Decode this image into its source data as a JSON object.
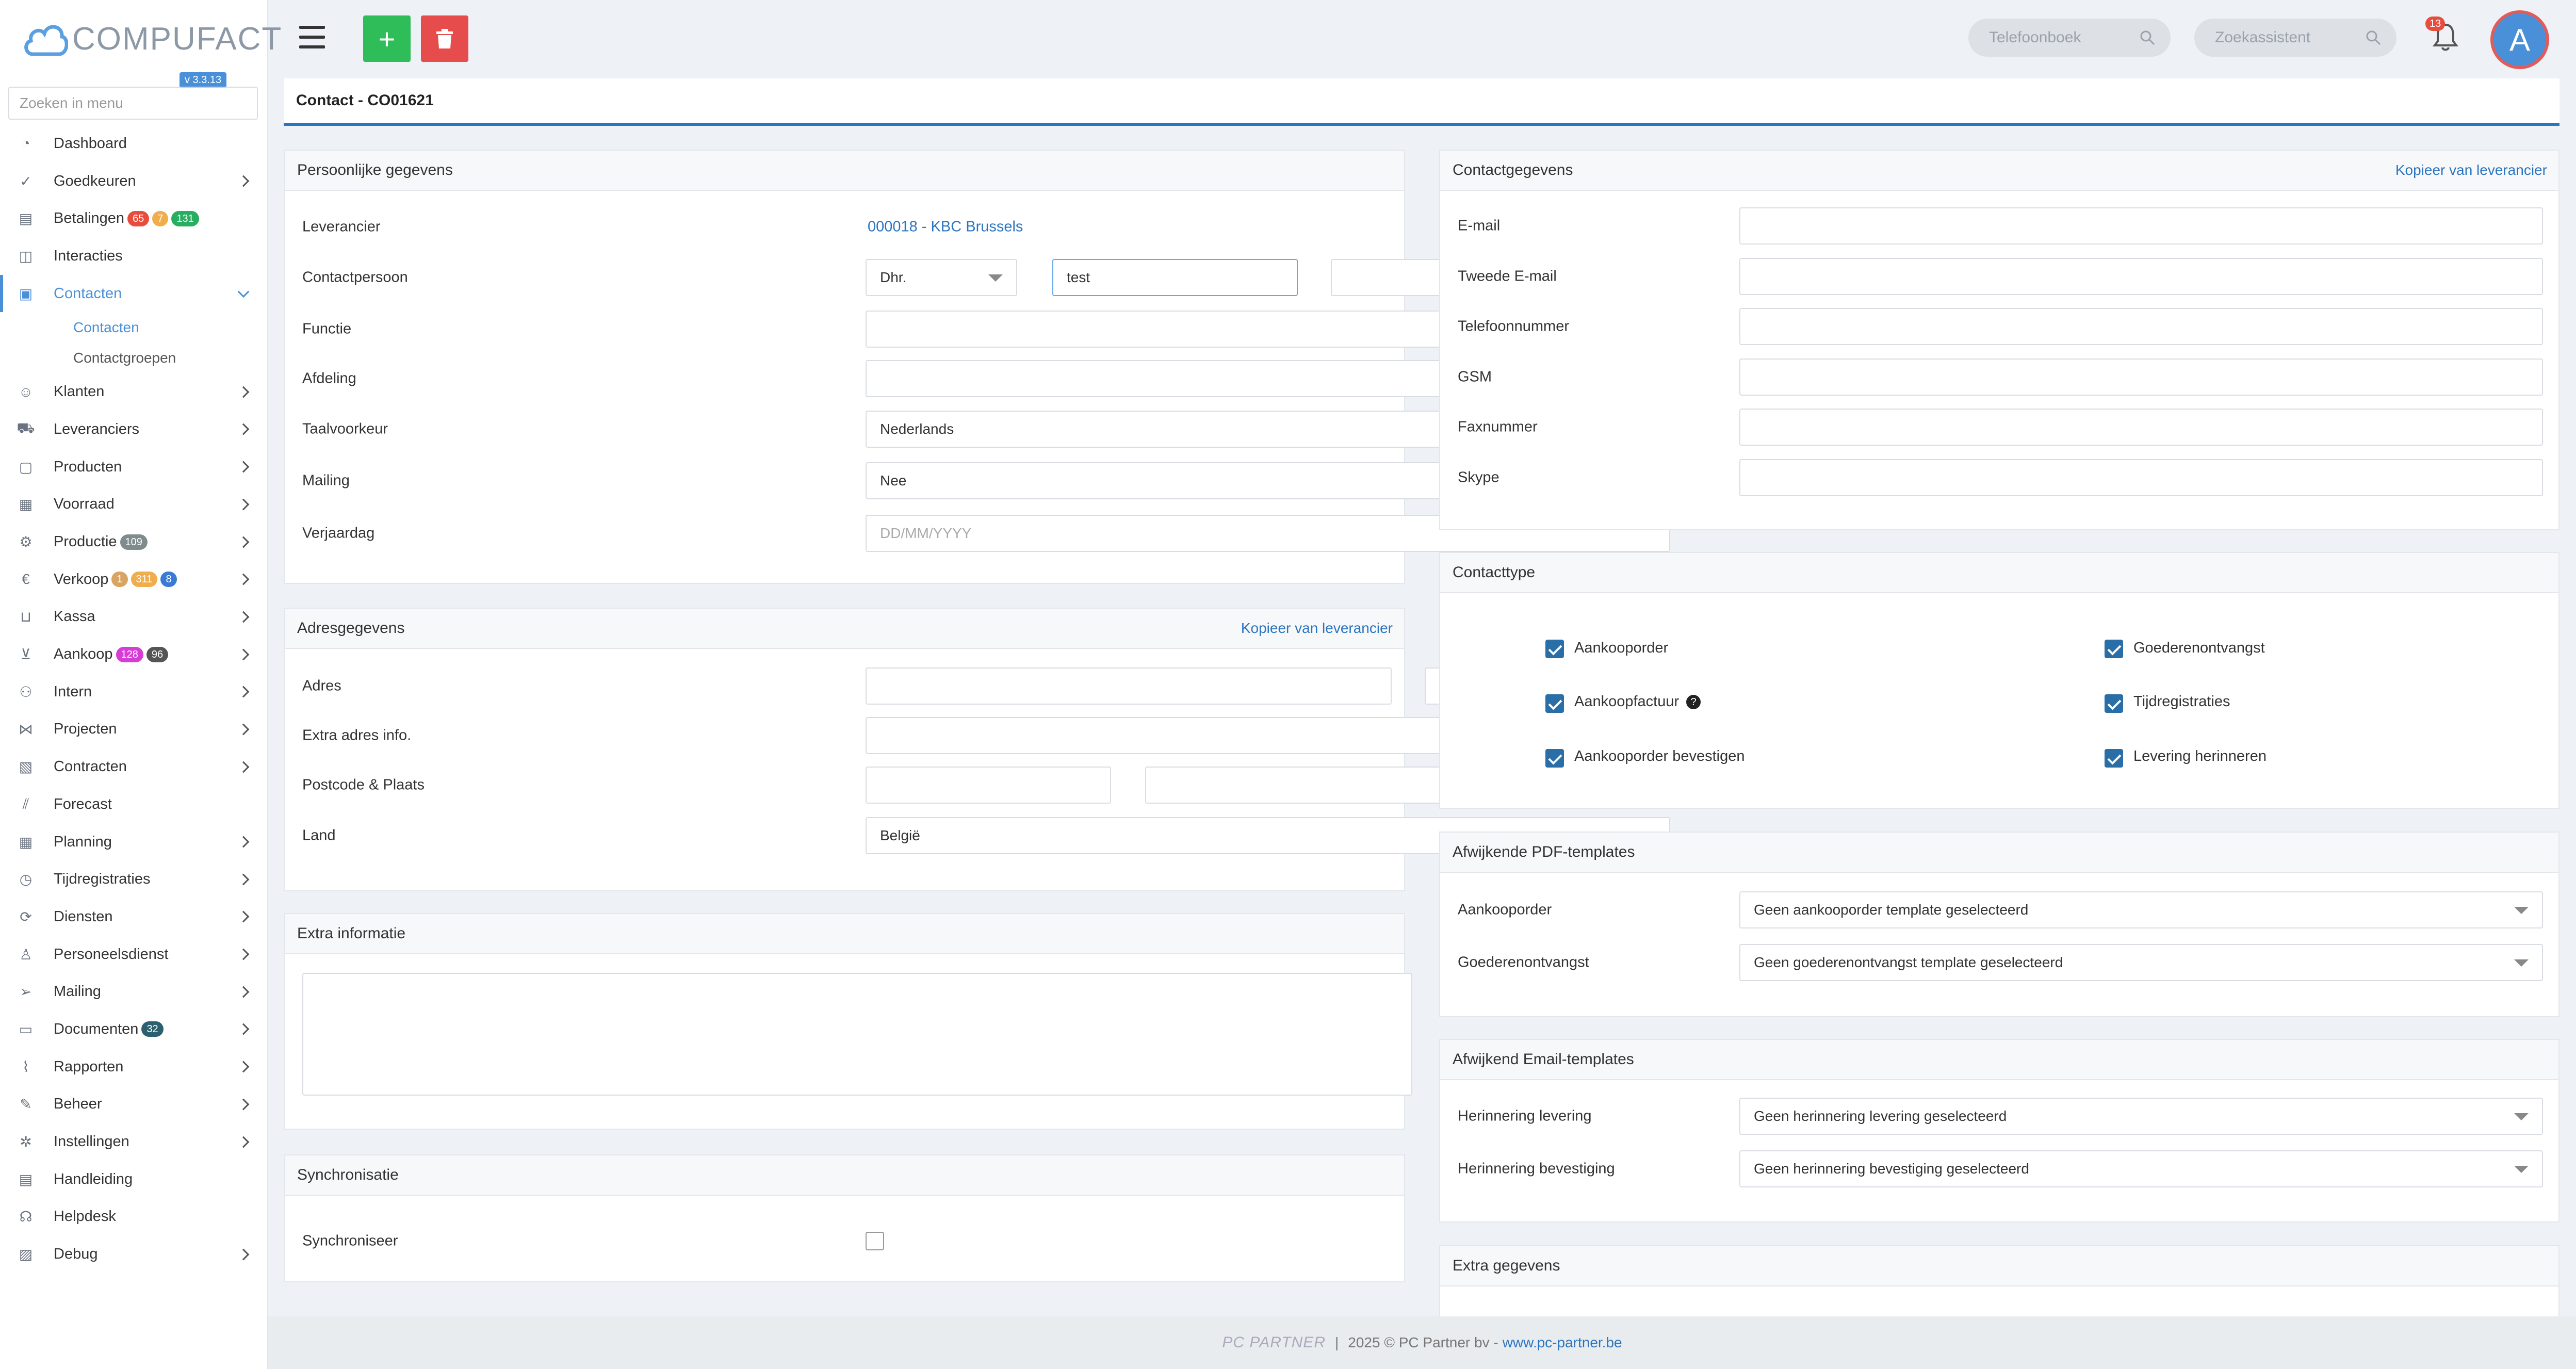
{
  "app": {
    "logo_text": "COMPUFACT",
    "version": "v 3.3.13",
    "menu_search_placeholder": "Zoeken in menu"
  },
  "sidebar": {
    "items": [
      {
        "label": "Dashboard",
        "icon": "dashboard-icon",
        "chevron": false
      },
      {
        "label": "Goedkeuren",
        "icon": "approve-icon",
        "chevron": true
      },
      {
        "label": "Betalingen",
        "icon": "payments-icon",
        "chevron": false,
        "badges": [
          {
            "text": "65",
            "color": "#e74c3c"
          },
          {
            "text": "7",
            "color": "#f0ad4e"
          },
          {
            "text": "131",
            "color": "#27ae60"
          }
        ]
      },
      {
        "label": "Interacties",
        "icon": "chat-icon",
        "chevron": false
      },
      {
        "label": "Contacten",
        "icon": "contact-card-icon",
        "chevron": true,
        "active": true,
        "expanded": true
      },
      {
        "label": "Klanten",
        "icon": "customer-icon",
        "chevron": true
      },
      {
        "label": "Leveranciers",
        "icon": "truck-icon",
        "chevron": true
      },
      {
        "label": "Producten",
        "icon": "box-icon",
        "chevron": true
      },
      {
        "label": "Voorraad",
        "icon": "stock-icon",
        "chevron": true
      },
      {
        "label": "Productie",
        "icon": "production-icon",
        "chevron": true,
        "badges": [
          {
            "text": "109",
            "color": "#7f8c8d"
          }
        ]
      },
      {
        "label": "Verkoop",
        "icon": "euro-icon",
        "chevron": true,
        "badges": [
          {
            "text": "1",
            "color": "#d9a463"
          },
          {
            "text": "311",
            "color": "#f0ad4e"
          },
          {
            "text": "8",
            "color": "#3a7bd5"
          }
        ]
      },
      {
        "label": "Kassa",
        "icon": "basket-icon",
        "chevron": true
      },
      {
        "label": "Aankoop",
        "icon": "cart-icon",
        "chevron": true,
        "badges": [
          {
            "text": "128",
            "color": "#d63cd6"
          },
          {
            "text": "96",
            "color": "#555555"
          }
        ]
      },
      {
        "label": "Intern",
        "icon": "team-icon",
        "chevron": true
      },
      {
        "label": "Projecten",
        "icon": "project-icon",
        "chevron": true
      },
      {
        "label": "Contracten",
        "icon": "contract-icon",
        "chevron": true
      },
      {
        "label": "Forecast",
        "icon": "chart-icon",
        "chevron": false
      },
      {
        "label": "Planning",
        "icon": "calendar-icon",
        "chevron": true
      },
      {
        "label": "Tijdregistraties",
        "icon": "clock-icon",
        "chevron": true
      },
      {
        "label": "Diensten",
        "icon": "refresh-icon",
        "chevron": true
      },
      {
        "label": "Personeelsdienst",
        "icon": "person-icon",
        "chevron": true
      },
      {
        "label": "Mailing",
        "icon": "send-icon",
        "chevron": true
      },
      {
        "label": "Documenten",
        "icon": "folder-icon",
        "chevron": true,
        "badges": [
          {
            "text": "32",
            "color": "#2c5f6f"
          }
        ]
      },
      {
        "label": "Rapporten",
        "icon": "report-icon",
        "chevron": true
      },
      {
        "label": "Beheer",
        "icon": "wrench-icon",
        "chevron": true
      },
      {
        "label": "Instellingen",
        "icon": "gear-icon",
        "chevron": true
      },
      {
        "label": "Handleiding",
        "icon": "book-icon",
        "chevron": false
      },
      {
        "label": "Helpdesk",
        "icon": "headset-icon",
        "chevron": false
      },
      {
        "label": "Debug",
        "icon": "debug-icon",
        "chevron": true
      }
    ],
    "submenu": [
      "Contacten",
      "Contactgroepen"
    ]
  },
  "topbar": {
    "add_label": "+",
    "phonebook_placeholder": "Telefoonboek",
    "assistant_placeholder": "Zoekassistent",
    "notification_count": "13",
    "avatar_letter": "A"
  },
  "page": {
    "title": "Contact - CO01621"
  },
  "personal": {
    "heading": "Persoonlijke gegevens",
    "supplier_label": "Leverancier",
    "supplier_value": "000018 - KBC Brussels",
    "contact_label": "Contactpersoon",
    "salutation": "Dhr.",
    "first_name": "test",
    "last_name": "",
    "function_label": "Functie",
    "department_label": "Afdeling",
    "language_label": "Taalvoorkeur",
    "language_value": "Nederlands",
    "mailing_label": "Mailing",
    "mailing_value": "Nee",
    "birthday_label": "Verjaardag",
    "birthday_placeholder": "DD/MM/YYYY"
  },
  "address": {
    "heading": "Adresgegevens",
    "copy_link": "Kopieer van leverancier",
    "address_label": "Adres",
    "extra_label": "Extra adres info.",
    "postal_label": "Postcode & Plaats",
    "country_label": "Land",
    "country_value": "België"
  },
  "extra_info": {
    "heading": "Extra informatie"
  },
  "sync": {
    "heading": "Synchronisatie",
    "label": "Synchroniseer",
    "checked": false
  },
  "contact": {
    "heading": "Contactgegevens",
    "copy_link": "Kopieer van leverancier",
    "fields": [
      "E-mail",
      "Tweede E-mail",
      "Telefoonnummer",
      "GSM",
      "Faxnummer",
      "Skype"
    ]
  },
  "contacttype": {
    "heading": "Contacttype",
    "options": [
      {
        "label": "Aankooporder",
        "checked": true
      },
      {
        "label": "Goederenontvangst",
        "checked": true
      },
      {
        "label": "Aankoopfactuur",
        "checked": true,
        "help": "?"
      },
      {
        "label": "Tijdregistraties",
        "checked": true
      },
      {
        "label": "Aankooporder bevestigen",
        "checked": true
      },
      {
        "label": "Levering herinneren",
        "checked": true
      }
    ]
  },
  "pdf_templates": {
    "heading": "Afwijkende PDF-templates",
    "order_label": "Aankooporder",
    "order_value": "Geen aankooporder template geselecteerd",
    "receipt_label": "Goederenontvangst",
    "receipt_value": "Geen goederenontvangst template geselecteerd"
  },
  "email_templates": {
    "heading": "Afwijkend Email-templates",
    "delivery_label": "Herinnering levering",
    "delivery_value": "Geen herinnering levering geselecteerd",
    "confirm_label": "Herinnering bevestiging",
    "confirm_value": "Geen herinnering bevestiging geselecteerd"
  },
  "extra_data": {
    "heading": "Extra gegevens"
  },
  "footer": {
    "logo": "PC PARTNER",
    "separator": "|",
    "copyright": "2025 © PC Partner bv -",
    "link": "www.pc-partner.be"
  }
}
